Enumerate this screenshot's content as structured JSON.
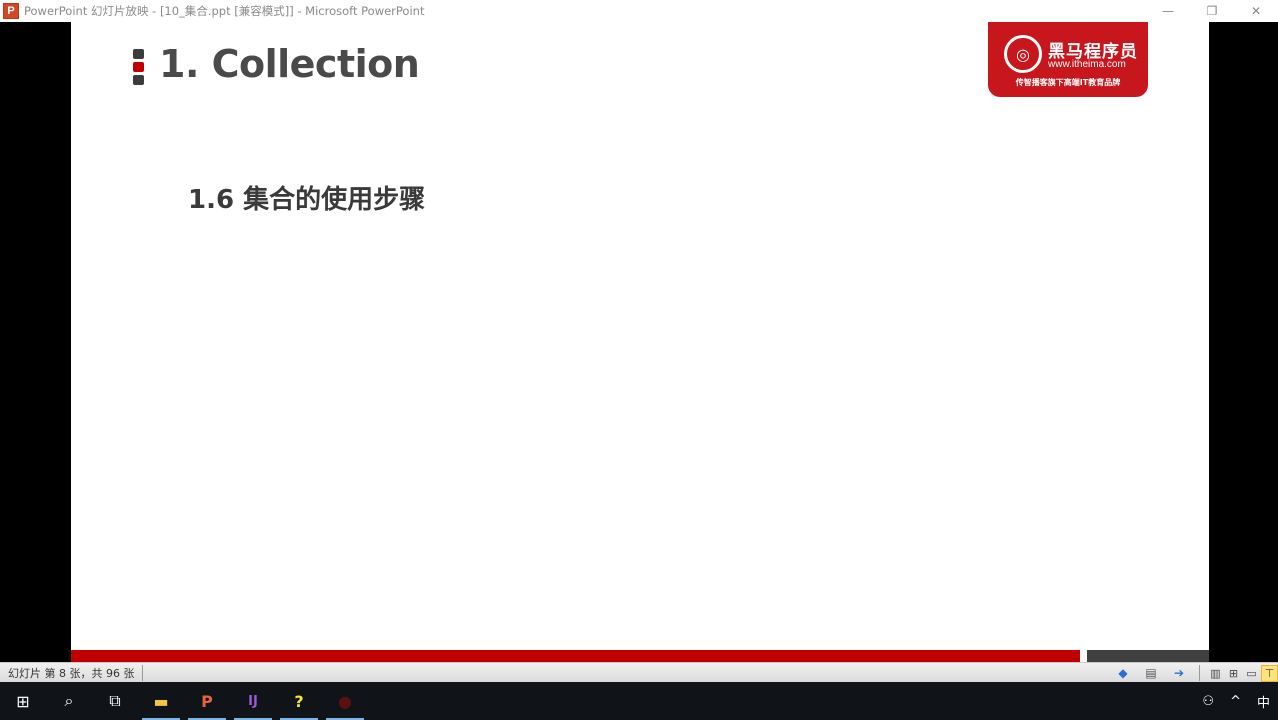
{
  "window": {
    "app_icon_letter": "P",
    "title": "PowerPoint 幻灯片放映 - [10_集合.ppt [兼容模式]] - Microsoft PowerPoint",
    "minimize": "—",
    "restore": "❐",
    "close": "✕"
  },
  "slide": {
    "title": "1. Collection",
    "subtitle": "1.6 集合的使用步骤",
    "logo": {
      "icon": "◎",
      "name": "黑马程序员",
      "url": "www.itheima.com",
      "slogan": "传智播客旗下高端IT教育品牌"
    },
    "colors": {
      "accent_red": "#c00000",
      "title_gray": "#4a4a4a",
      "logo_red": "#c8161d"
    }
  },
  "statusbar": {
    "slide_info": "幻灯片 第 8 张，共 96 张",
    "current_slide": 8,
    "total_slides": 96,
    "prev_icon": "◆",
    "notes_icon": "▤",
    "next_icon": "➔",
    "views": [
      "▥",
      "⊞",
      "▭",
      "⊤"
    ]
  },
  "taskbar": {
    "items": [
      {
        "name": "start",
        "icon": "⊞"
      },
      {
        "name": "search",
        "icon": "⌕"
      },
      {
        "name": "task-view",
        "icon": "⧉"
      },
      {
        "name": "file-explorer",
        "icon": "▬"
      },
      {
        "name": "powerpoint",
        "icon": "P"
      },
      {
        "name": "intellij",
        "icon": "IJ"
      },
      {
        "name": "help",
        "icon": "?"
      },
      {
        "name": "app-red",
        "icon": "●"
      }
    ],
    "tray": {
      "people_icon": "⚇",
      "chevron": "^",
      "ime": "中"
    }
  }
}
